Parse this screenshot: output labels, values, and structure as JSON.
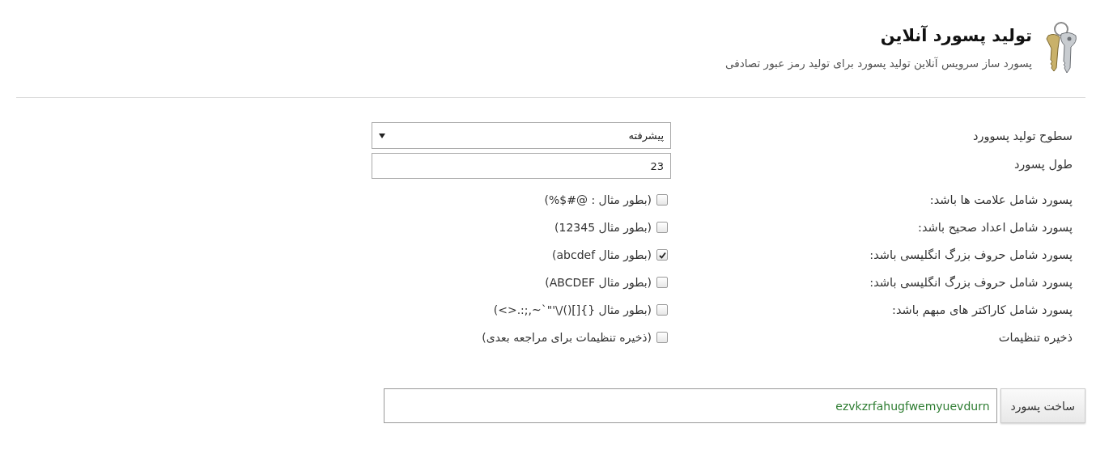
{
  "header": {
    "title": "تولید پسورد آنلاین",
    "subtitle": "پسورد ساز سرویس آنلاین تولید پسورد برای تولید رمز عبور تصادفی"
  },
  "fields": [
    {
      "kind": "select",
      "label": "سطوح تولید پسوورد",
      "value": "پیشرفته"
    },
    {
      "kind": "text",
      "label": "طول پسورد",
      "value": "23"
    },
    {
      "kind": "checkbox",
      "label": "پسورد شامل علامت ها باشد:",
      "hint": "(بطور مثال : @#$%)",
      "checked": false
    },
    {
      "kind": "checkbox",
      "label": "پسورد شامل اعداد صحیح باشد:",
      "hint": "(بطور مثال 12345)",
      "checked": false
    },
    {
      "kind": "checkbox",
      "label": "پسورد شامل حروف بزرگ انگلیسی باشد:",
      "hint": "(بطور مثال abcdef)",
      "checked": true
    },
    {
      "kind": "checkbox",
      "label": "پسورد شامل حروف بزرگ انگلیسی باشد:",
      "hint": "(بطور مثال ABCDEF)",
      "checked": false
    },
    {
      "kind": "checkbox",
      "label": "پسورد شامل کاراکتر های مبهم باشد:",
      "hint": "(بطور مثال {}[]()/\\'\"`~,;:.<>)",
      "checked": false
    },
    {
      "kind": "checkbox",
      "label": "ذخیره تنظیمات",
      "hint": "(ذخیره تنظیمات برای مراجعه بعدی)",
      "checked": false
    }
  ],
  "generate": {
    "button": "ساخت پسورد",
    "result": "ezvkzrfahugfwemyuevdurn"
  }
}
